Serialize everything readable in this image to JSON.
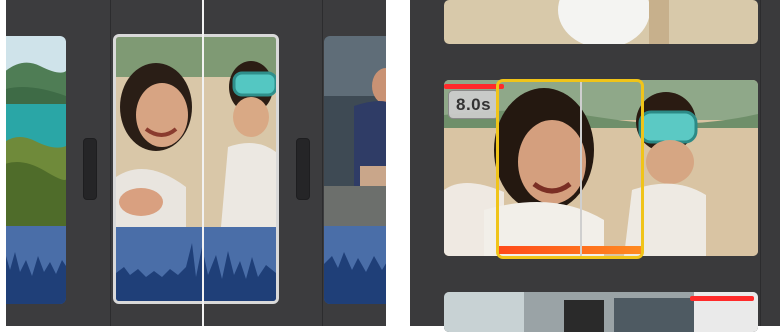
{
  "selected_clip": {
    "duration_label": "8.0s"
  },
  "colors": {
    "timeline_bg": "#3c3c3e",
    "audio_waveform_bg": "#4a6ea8",
    "audio_waveform_fill": "#1f3f78",
    "selection_yellow": "#f0c419",
    "speed_bar_orange": "#ff7a1e",
    "marker_red": "#ff2a2a",
    "playhead_white": "#f2f2f2"
  },
  "icons": [
    "transition-icon",
    "transition-icon"
  ]
}
